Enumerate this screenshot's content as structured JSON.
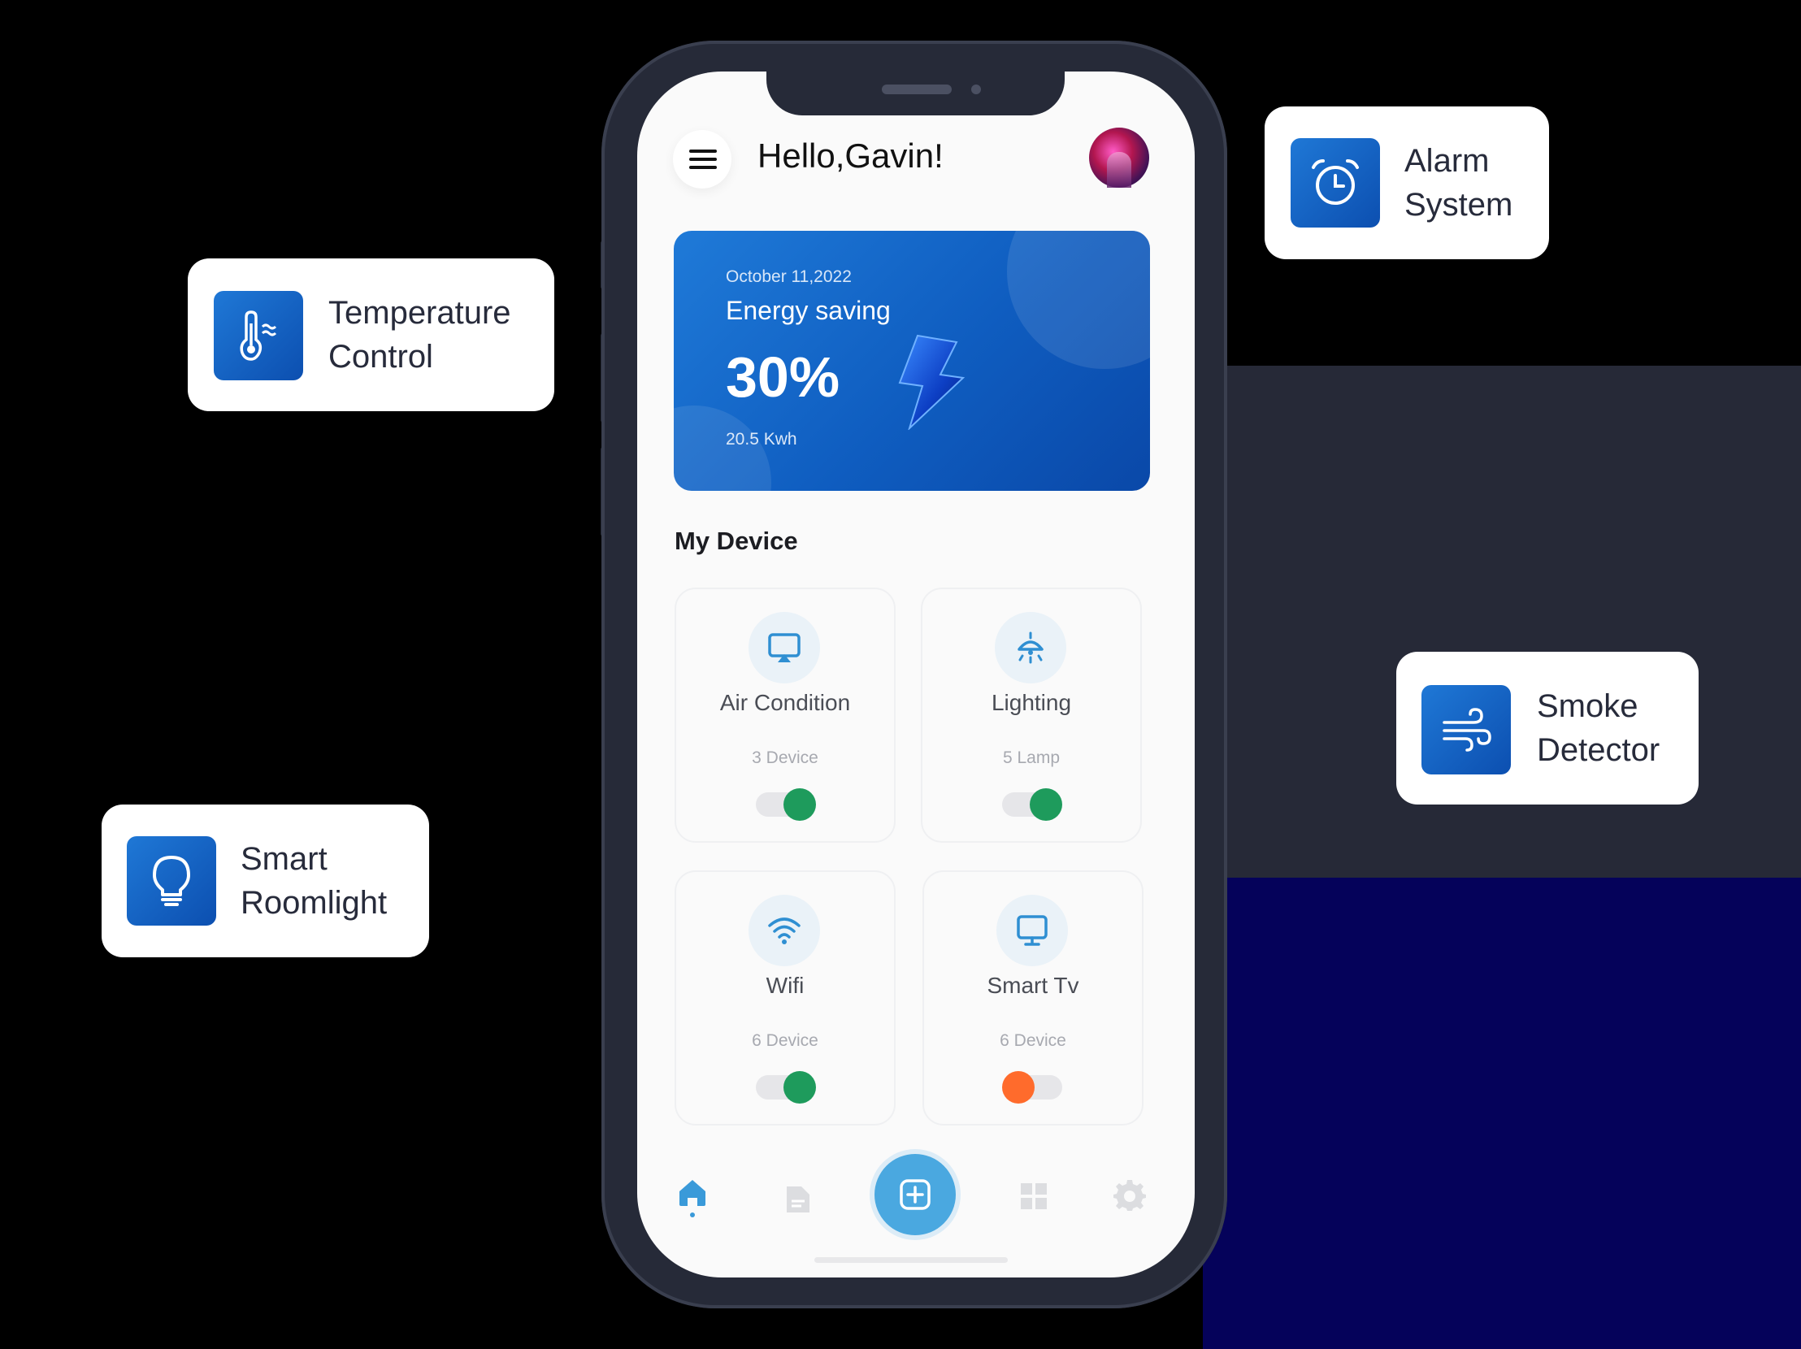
{
  "header": {
    "greeting": "Hello,Gavin!"
  },
  "energy_card": {
    "date": "October 11,2022",
    "title": "Energy saving",
    "percent": "30%",
    "energy": "20.5 Kwh"
  },
  "devices": {
    "title": "My Device",
    "items": [
      {
        "name": "Air Condition",
        "count": "3 Device",
        "on": true,
        "icon": "air-conditioner-icon"
      },
      {
        "name": "Lighting",
        "count": "5 Lamp",
        "on": true,
        "icon": "lamp-icon"
      },
      {
        "name": "Wifi",
        "count": "6 Device",
        "on": true,
        "icon": "wifi-icon"
      },
      {
        "name": "Smart Tv",
        "count": "6 Device",
        "on": false,
        "icon": "monitor-icon"
      }
    ]
  },
  "bottom_nav": [
    "home-icon",
    "document-icon",
    "add-icon",
    "grid-icon",
    "gear-icon"
  ],
  "features": [
    {
      "line1": "Temperature",
      "line2": "Control",
      "icon": "thermometer-icon"
    },
    {
      "line1": "Alarm",
      "line2": "System",
      "icon": "alarm-clock-icon"
    },
    {
      "line1": "Smoke",
      "line2": "Detector",
      "icon": "wind-icon"
    },
    {
      "line1": "Smart",
      "line2": "Roomlight",
      "icon": "lightbulb-icon"
    }
  ],
  "colors": {
    "accent": "#1565c8",
    "toggle_on": "#1e9b5c",
    "toggle_off": "#ff6b2c",
    "nav_active": "#3a9ad9"
  }
}
